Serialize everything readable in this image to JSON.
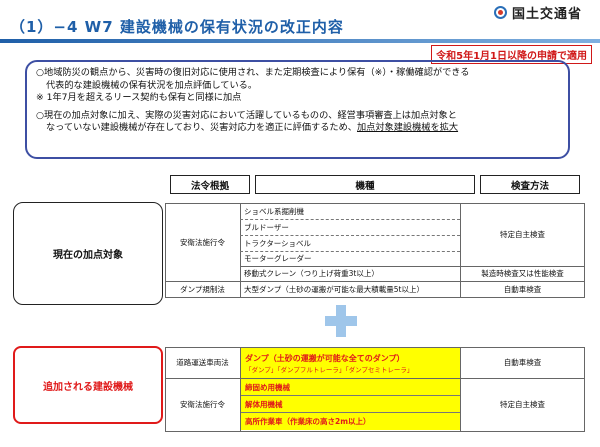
{
  "header": {
    "ministry": "国土交通省",
    "title": "（1）−4  W7  建設機械の保有状況の改正内容",
    "badge": "令和5年1月1日以降の申請で適用"
  },
  "intro": {
    "p1a": "○地域防災の観点から、災害時の復旧対応に使用され、また定期検査により保有（※）・稼働確認ができる",
    "p1b": "代表的な建設機械の保有状況を加点評価している。",
    "note": "※  1年7月を超えるリース契約も保有と同様に加点",
    "p2a": "○現在の加点対象に加え、実際の災害対応において活躍しているものの、経営事項審査上は加点対象と",
    "p2b_plain": "なっていない建設機械が存在しており、災害対応力を適正に評価するため、",
    "p2b_ul": "加点対象建設機械を拡大"
  },
  "table": {
    "headers": {
      "law": "法令根拠",
      "machine": "機種",
      "inspection": "検査方法"
    },
    "current_label": "現在の加点対象",
    "added_label": "追加される建設機械",
    "current_rows": {
      "law_anei": "安衛法施行令",
      "law_dump": "ダンプ規制法",
      "machines": [
        "ショベル系掘削機",
        "ブルドーザー",
        "トラクターショベル",
        "モーターグレーダー",
        "移動式クレーン（つり上げ荷重3t以上）",
        "大型ダンプ（土砂の運搬が可能な最大積載量5t以上）"
      ],
      "insp_specific": "特定自主検査",
      "insp_crane": "製造時検査又は性能検査",
      "insp_vehicle": "自動車検査"
    },
    "added_rows": {
      "law_road": "道路運送車両法",
      "law_anei": "安衛法施行令",
      "dump_main": "ダンプ（土砂の運搬が可能な全てのダンプ）",
      "dump_sub": "「ダンプ」「ダンプフルトレーラ」「ダンプセミトレーラ」",
      "machines": [
        "締固め用機械",
        "解体用機械",
        "高所作業車（作業床の高さ2m以上）"
      ],
      "insp_vehicle": "自動車検査",
      "insp_specific": "特定自主検査"
    }
  },
  "colors": {
    "title_blue": "#1f5fa8",
    "accent_red": "#e01a1a",
    "highlight": "#ffff00",
    "plus": "#9fc6ea"
  }
}
